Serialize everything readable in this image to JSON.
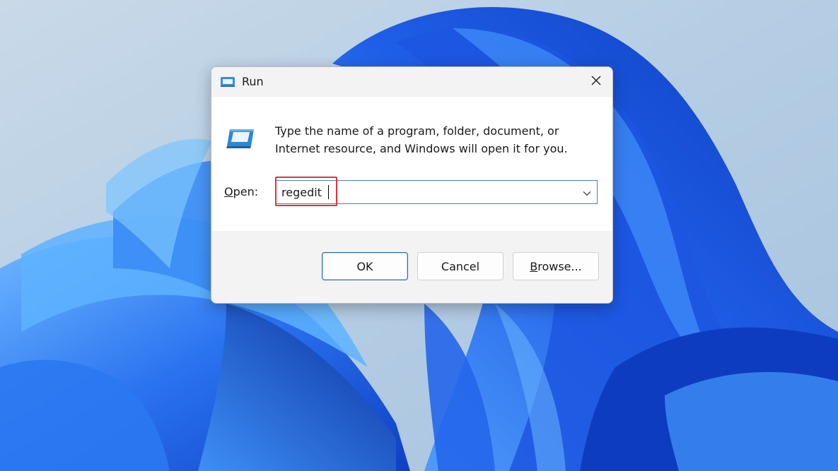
{
  "dialog": {
    "title": "Run",
    "description": "Type the name of a program, folder, document, or Internet resource, and Windows will open it for you.",
    "open_label_prefix": "O",
    "open_label_rest": "pen:",
    "open_value": "regedit",
    "buttons": {
      "ok": "OK",
      "cancel": "Cancel",
      "browse_prefix": "B",
      "browse_rest": "rowse..."
    }
  },
  "colors": {
    "highlight": "#e2323a",
    "accent": "#2b6aa6",
    "wallpaper_blue": "#1f5fe8"
  },
  "icons": [
    "run-app-icon",
    "close-icon",
    "chevron-down-icon"
  ]
}
